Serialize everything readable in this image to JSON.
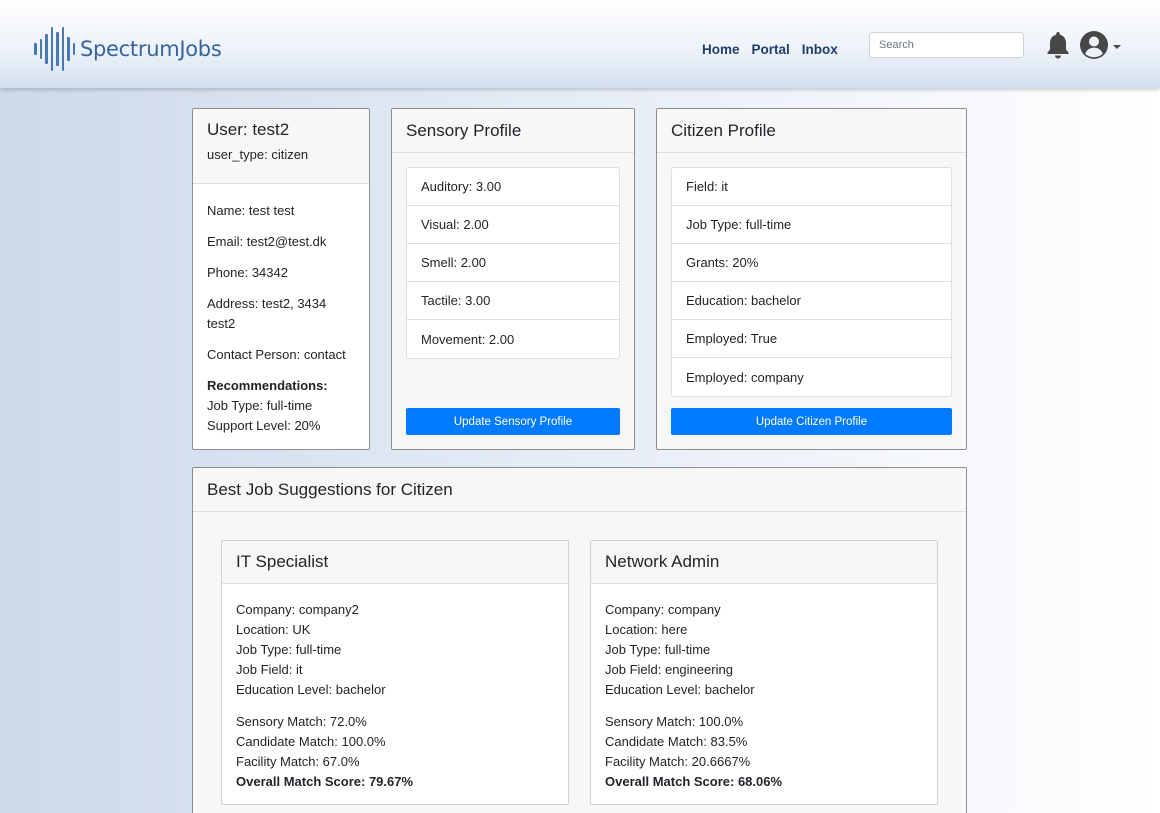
{
  "header": {
    "logo_text": "SpectrumJobs",
    "nav": [
      "Home",
      "Portal",
      "Inbox"
    ],
    "search_placeholder": "Search",
    "icons": [
      "bell-icon",
      "user-avatar-icon",
      "caret-down-icon"
    ]
  },
  "user": {
    "title": "User: test2",
    "user_type": "user_type: citizen",
    "name": "Name: test test",
    "email": "Email: test2@test.dk",
    "phone": "Phone: 34342",
    "address_line1": "Address: test2, 3434",
    "address_line2": "test2",
    "contact": "Contact Person: contact",
    "rec_title": "Recommendations:",
    "rec_job_type": "Job Type: full-time",
    "rec_support": "Support Level: 20%"
  },
  "sensory": {
    "title": "Sensory Profile",
    "items": [
      "Auditory: 3.00",
      "Visual: 2.00",
      "Smell: 2.00",
      "Tactile: 3.00",
      "Movement: 2.00"
    ],
    "button": "Update Sensory Profile"
  },
  "citizen": {
    "title": "Citizen Profile",
    "items": [
      "Field: it",
      "Job Type: full-time",
      "Grants: 20%",
      "Education: bachelor",
      "Employed: True",
      "Employed: company"
    ],
    "button": "Update Citizen Profile"
  },
  "jobs": {
    "title": "Best Job Suggestions for Citizen",
    "items": [
      {
        "title": "IT Specialist",
        "company": "Company: company2",
        "location": "Location: UK",
        "job_type": "Job Type: full-time",
        "job_field": "Job Field: it",
        "education": "Education Level: bachelor",
        "sensory": "Sensory Match: 72.0%",
        "candidate": "Candidate Match: 100.0%",
        "facility": "Facility Match: 67.0%",
        "overall": "Overall Match Score: 79.67%"
      },
      {
        "title": "Network Admin",
        "company": "Company: company",
        "location": "Location: here",
        "job_type": "Job Type: full-time",
        "job_field": "Job Field: engineering",
        "education": "Education Level: bachelor",
        "sensory": "Sensory Match: 100.0%",
        "candidate": "Candidate Match: 83.5%",
        "facility": "Facility Match: 20.6667%",
        "overall": "Overall Match Score: 68.06%"
      }
    ]
  }
}
